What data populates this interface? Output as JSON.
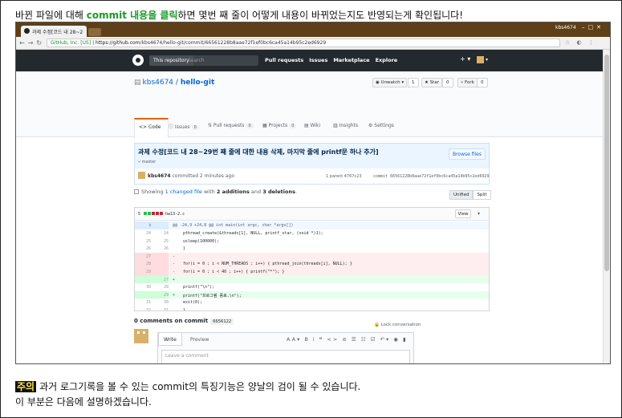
{
  "caption": {
    "prefix": "바뀐 파일에 대해 ",
    "highlight": "commit 내용을 클릭",
    "suffix": "하면 몇번 째 줄이 어떻게 내용이 바뀌었는지도 반영되는게 확인됩니다!"
  },
  "browser": {
    "tab_title": "과제 수정[코드 내 28~2",
    "window_user": "kbs4674",
    "url_secure": "GitHub, Inc. [US]",
    "url_host": "https://github.com",
    "url_path": "/kbs4674/hello-git/commit/66561228b8aae72f1ef0bc6ca45a14b95c2ed6929"
  },
  "github": {
    "search_scope": "This repository",
    "search_placeholder": "Search",
    "nav": [
      "Pull requests",
      "Issues",
      "Marketplace",
      "Explore"
    ],
    "plus": "+ ▾"
  },
  "repo": {
    "owner": "kbs4674",
    "sep": " / ",
    "name": "hello-git",
    "unwatch_label": "◉ Unwatch ▾",
    "unwatch_count": "1",
    "star_label": "★ Star",
    "star_count": "0",
    "fork_label": "⑂ Fork",
    "fork_count": "0",
    "tabs": [
      {
        "label": "<> Code"
      },
      {
        "label": "ⓘ Issues",
        "count": "0"
      },
      {
        "label": "⇅ Pull requests",
        "count": "0"
      },
      {
        "label": "▦ Projects",
        "count": "0"
      },
      {
        "label": "▤ Wiki"
      },
      {
        "label": "▥ Insights"
      },
      {
        "label": "⚙ Settings"
      }
    ]
  },
  "commit": {
    "message": "과제 수정[코드 내 28~29번 째 줄에 대한 내용 삭제, 마지막 줄에 printf문 하나 추가]",
    "branch": "⑂ master",
    "browse_label": "Browse files",
    "author": "kbs4674",
    "time": "committed 2 minutes ago",
    "parent": "1 parent  4767c23",
    "sha": "commit  66561228b8aae72f1ef0bc6ca45a14b95c2ed6929"
  },
  "summary": {
    "prefix": "Showing ",
    "changed": "1 changed file",
    "mid": " with ",
    "additions": "2 additions",
    "and": " and ",
    "deletions": "3 deletions",
    "end": ".",
    "unified_label": "Unified",
    "split_label": "Split"
  },
  "diff": {
    "file_count": "5",
    "file_name": "hw13-2.c",
    "view_label": "View",
    "hunk": "@@ -24,9 +24,8 @@ int main(int argc, char *argv[])",
    "lines": [
      {
        "type": "ctx",
        "old": "24",
        "new": "24",
        "sign": "",
        "code": "        pthread_create(&threads[1], NULL, printf_star, (void *)1);"
      },
      {
        "type": "ctx",
        "old": "25",
        "new": "25",
        "sign": "",
        "code": "        usleep(100000);"
      },
      {
        "type": "ctx",
        "old": "26",
        "new": "26",
        "sign": "",
        "code": "    }"
      },
      {
        "type": "del",
        "old": "27",
        "new": "",
        "sign": "-",
        "code": ""
      },
      {
        "type": "del",
        "old": "28",
        "new": "",
        "sign": "-",
        "code": "    for(i = 0 ; i < NUM_THREADS ; i++) { pthread_join(threads[i], NULL); }"
      },
      {
        "type": "del",
        "old": "29",
        "new": "",
        "sign": "-",
        "code": "    for(i = 0 ; i < 40 ; i++) { printf(\"*\"); }"
      },
      {
        "type": "add",
        "old": "",
        "new": "27",
        "sign": "+",
        "code": ""
      },
      {
        "type": "ctx",
        "old": "30",
        "new": "28",
        "sign": "",
        "code": "    printf(\"\\n\");"
      },
      {
        "type": "add",
        "old": "",
        "new": "29",
        "sign": "+",
        "code": "    printf(\"프로그램 종료.\\n\");"
      },
      {
        "type": "ctx",
        "old": "31",
        "new": "30",
        "sign": "",
        "code": "    exit(0);"
      },
      {
        "type": "ctx",
        "old": "32",
        "new": "31",
        "sign": "",
        "code": "}"
      }
    ]
  },
  "comments": {
    "title": "0 comments on commit",
    "sha": "6656122",
    "lock_label": "🔒 Lock conversation",
    "write_tab": "Write",
    "preview_tab": "Preview",
    "tools": "AA▾ B i  ❝ <> ⊘  ☰ ☷ ☑  ↶▾ ◉ ▮",
    "placeholder": "Leave a comment"
  },
  "bottom": {
    "warn_label": "주의",
    "line1": "과거 로그기록을 볼 수 있는 commit의 특징기능은 양날의 검이 될 수 있습니다.",
    "line2": "이 부분은 다음에 설명하겠습니다."
  },
  "colors": {
    "caption_highlight": "#1a9a28",
    "gh_header": "#24292e",
    "link": "#0366d6",
    "add_bg": "#e6ffed",
    "del_bg": "#ffeef0",
    "warn_bg": "#111111",
    "warn_text": "#ffe23a"
  }
}
